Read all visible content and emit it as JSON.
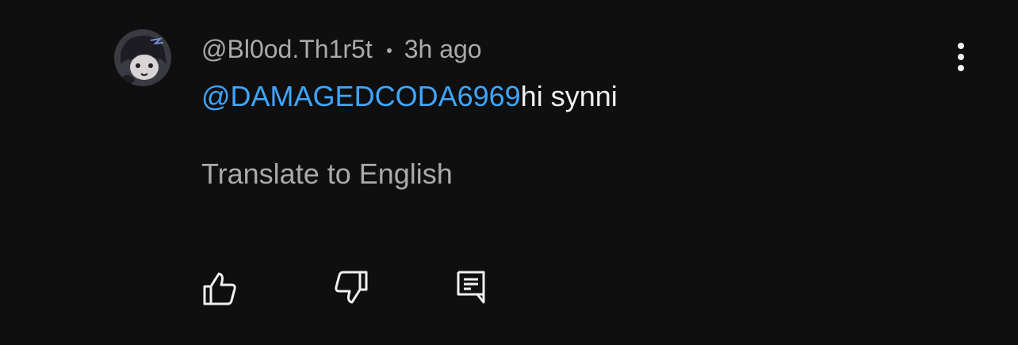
{
  "comment": {
    "author": "@Bl0od.Th1r5t",
    "time": "3h ago",
    "mention": "@DAMAGEDCODA6969",
    "text": "hi synni",
    "translate_label": "Translate to English"
  },
  "icons": {
    "more": "more-vertical-icon",
    "like": "thumbs-up-icon",
    "dislike": "thumbs-down-icon",
    "reply": "reply-comment-icon"
  },
  "colors": {
    "background": "#0f0f0f",
    "primary_text": "#f1f1f1",
    "secondary_text": "#aaaaaa",
    "link": "#3ea6ff"
  }
}
